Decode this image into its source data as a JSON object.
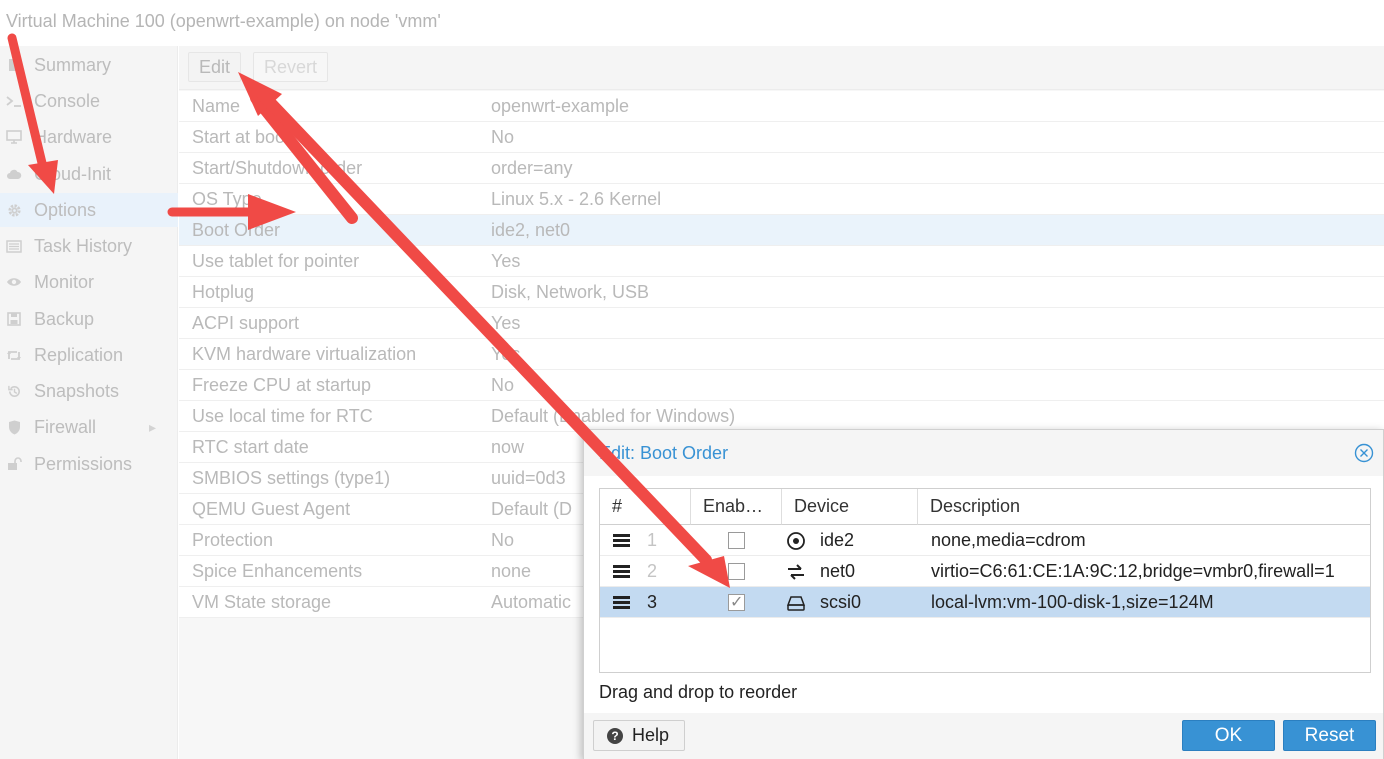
{
  "window": {
    "title": "Virtual Machine 100 (openwrt-example) on node 'vmm'"
  },
  "sidebar": {
    "items": [
      {
        "label": "Summary",
        "icon": "summary-icon"
      },
      {
        "label": "Console",
        "icon": "console-icon"
      },
      {
        "label": "Hardware",
        "icon": "monitor-icon"
      },
      {
        "label": "Cloud-Init",
        "icon": "cloud-icon"
      },
      {
        "label": "Options",
        "icon": "gear-icon",
        "selected": true
      },
      {
        "label": "Task History",
        "icon": "list-icon"
      },
      {
        "label": "Monitor",
        "icon": "eye-icon"
      },
      {
        "label": "Backup",
        "icon": "floppy-icon"
      },
      {
        "label": "Replication",
        "icon": "retweet-icon"
      },
      {
        "label": "Snapshots",
        "icon": "history-icon"
      },
      {
        "label": "Firewall",
        "icon": "shield-icon"
      },
      {
        "label": "Permissions",
        "icon": "unlock-icon"
      }
    ]
  },
  "toolbar": {
    "edit_label": "Edit",
    "revert_label": "Revert"
  },
  "options": {
    "rows": [
      {
        "key": "Name",
        "value": "openwrt-example"
      },
      {
        "key": "Start at boot",
        "value": "No"
      },
      {
        "key": "Start/Shutdown order",
        "value": "order=any"
      },
      {
        "key": "OS Type",
        "value": "Linux 5.x - 2.6 Kernel"
      },
      {
        "key": "Boot Order",
        "value": "ide2, net0",
        "selected": true
      },
      {
        "key": "Use tablet for pointer",
        "value": "Yes"
      },
      {
        "key": "Hotplug",
        "value": "Disk, Network, USB"
      },
      {
        "key": "ACPI support",
        "value": "Yes"
      },
      {
        "key": "KVM hardware virtualization",
        "value": "Yes"
      },
      {
        "key": "Freeze CPU at startup",
        "value": "No"
      },
      {
        "key": "Use local time for RTC",
        "value": "Default (Enabled for Windows)"
      },
      {
        "key": "RTC start date",
        "value": "now"
      },
      {
        "key": "SMBIOS settings (type1)",
        "value": "uuid=0d3"
      },
      {
        "key": "QEMU Guest Agent",
        "value": "Default (D"
      },
      {
        "key": "Protection",
        "value": "No"
      },
      {
        "key": "Spice Enhancements",
        "value": "none"
      },
      {
        "key": "VM State storage",
        "value": "Automatic"
      }
    ]
  },
  "dialog": {
    "title": "Edit: Boot Order",
    "columns": {
      "order": "#",
      "enabled": "Enab…",
      "device": "Device",
      "description": "Description"
    },
    "rows": [
      {
        "order": "1",
        "enabled": false,
        "device": "ide2",
        "device_icon": "disc-icon",
        "description": "none,media=cdrom"
      },
      {
        "order": "2",
        "enabled": false,
        "device": "net0",
        "device_icon": "exchange-icon",
        "description": "virtio=C6:61:CE:1A:9C:12,bridge=vmbr0,firewall=1"
      },
      {
        "order": "3",
        "enabled": true,
        "device": "scsi0",
        "device_icon": "hdd-icon",
        "description": "local-lvm:vm-100-disk-1,size=124M",
        "selected": true
      }
    ],
    "hint": "Drag and drop to reorder",
    "help_label": "Help",
    "ok_label": "OK",
    "reset_label": "Reset"
  },
  "colors": {
    "accent": "#3892d4",
    "arrow": "#f04a46",
    "selected_row": "#c3daf1"
  }
}
